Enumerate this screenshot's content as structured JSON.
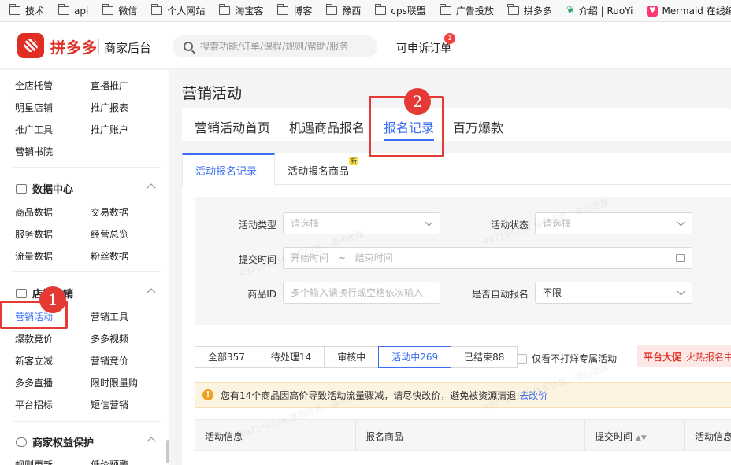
{
  "bookmarks": [
    {
      "label": "技术",
      "icon": "folder-icon"
    },
    {
      "label": "api",
      "icon": "folder-icon"
    },
    {
      "label": "微信",
      "icon": "folder-icon"
    },
    {
      "label": "个人网站",
      "icon": "folder-icon"
    },
    {
      "label": "淘宝客",
      "icon": "folder-icon"
    },
    {
      "label": "博客",
      "icon": "folder-icon"
    },
    {
      "label": "豫西",
      "icon": "folder-icon"
    },
    {
      "label": "cps联盟",
      "icon": "folder-icon"
    },
    {
      "label": "广告投放",
      "icon": "folder-icon"
    },
    {
      "label": "拼多多",
      "icon": "folder-icon"
    },
    {
      "label": "介绍 | RuoYi",
      "icon": "ruoyi-icon"
    },
    {
      "label": "Mermaid 在线编辑",
      "icon": "mermaid-icon"
    }
  ],
  "header": {
    "brand": "拼多多",
    "subtitle": "商家后台",
    "search_placeholder": "搜索功能/订单/课程/规则/帮助/服务",
    "complaint_label": "可申诉订单",
    "complaint_count": "1"
  },
  "sidebar": {
    "top_items": [
      "全店托管",
      "直播推广",
      "明星店铺",
      "推广报表",
      "推广工具",
      "推广账户",
      "营销书院"
    ],
    "data_center": {
      "title": "数据中心",
      "items": [
        "商品数据",
        "交易数据",
        "服务数据",
        "经营总览",
        "流量数据",
        "粉丝数据"
      ]
    },
    "store_marketing": {
      "title": "店铺营销",
      "items": [
        "营销活动",
        "营销工具",
        "爆款竞价",
        "多多视频",
        "新客立减",
        "营销竞价",
        "多多直播",
        "限时限量购",
        "平台招标",
        "短信营销"
      ]
    },
    "merchant_rights": {
      "title": "商家权益保护",
      "items": [
        "规则更新",
        "低价预警"
      ]
    }
  },
  "main": {
    "title": "营销活动",
    "tabs": [
      "营销活动首页",
      "机遇商品报名",
      "报名记录",
      "百万爆款"
    ],
    "active_tab": "报名记录",
    "subtabs": [
      "活动报名记录",
      "活动报名商品"
    ],
    "new_badge": "新",
    "filters": {
      "activity_type_label": "活动类型",
      "activity_type_placeholder": "请选择",
      "activity_status_label": "活动状态",
      "activity_status_placeholder": "请选择",
      "submit_time_label": "提交时间",
      "start_placeholder": "开始时间",
      "range_sep": "~",
      "end_placeholder": "结束时间",
      "product_id_label": "商品ID",
      "product_id_placeholder": "多个输入请换行或空格依次输入",
      "auto_signup_label": "是否自动报名",
      "auto_signup_value": "不限"
    },
    "status_buttons": [
      "全部357",
      "待处理14",
      "审核中",
      "活动中269",
      "已结束88"
    ],
    "active_status": "活动中269",
    "exclusive_checkbox": "仅看不打烊专属活动",
    "promo": {
      "tag": "平台大促",
      "text": "火热报名中"
    },
    "notice": {
      "text": "您有14个商品因高价导致活动流量骤减，请尽快改价，避免被资源清退",
      "link": "去改价"
    },
    "table_headers": [
      "活动信息",
      "报名商品",
      "提交时间",
      "活动信息"
    ],
    "watermark": "497184236 保密信息，请勿泄露"
  },
  "annotations": [
    "1",
    "2"
  ],
  "colors": {
    "brand": "#e02e24",
    "accent": "#3b6ef5",
    "annotation": "#e53935"
  }
}
